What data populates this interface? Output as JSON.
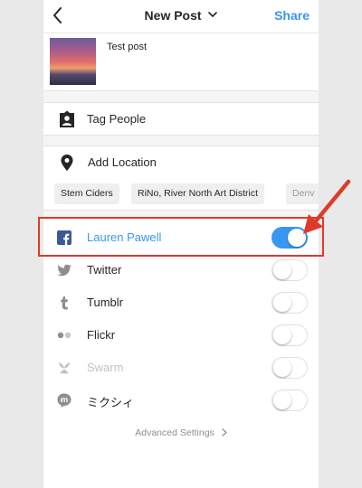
{
  "nav": {
    "back_icon": "chevron-left-icon",
    "title": "New Post",
    "title_icon": "chevron-down-icon",
    "share_label": "Share",
    "accent_color": "#3897f0"
  },
  "post": {
    "thumbnail": "sunset-photo",
    "caption": "Test post"
  },
  "tag_people": {
    "icon": "person-tag-icon",
    "label": "Tag People"
  },
  "location": {
    "icon": "location-pin-icon",
    "label": "Add Location",
    "suggestions": [
      "Stem Ciders",
      "RiNo, River North Art District",
      "Denv"
    ]
  },
  "share_to": [
    {
      "service": "Facebook",
      "icon": "facebook-icon",
      "label": "Lauren Pawell",
      "on": true
    },
    {
      "service": "Twitter",
      "icon": "twitter-icon",
      "label": "Twitter",
      "on": false
    },
    {
      "service": "Tumblr",
      "icon": "tumblr-icon",
      "label": "Tumblr",
      "on": false
    },
    {
      "service": "Flickr",
      "icon": "flickr-icon",
      "label": "Flickr",
      "on": false
    },
    {
      "service": "Swarm",
      "icon": "swarm-icon",
      "label": "Swarm",
      "on": false
    },
    {
      "service": "Mixi",
      "icon": "mixi-icon",
      "label": "ミクシィ",
      "on": false
    }
  ],
  "advanced": {
    "label": "Advanced Settings",
    "icon": "chevron-right-icon"
  },
  "annotation": {
    "highlight_color": "#e0392b",
    "arrow_icon": "red-arrow-annotation"
  }
}
